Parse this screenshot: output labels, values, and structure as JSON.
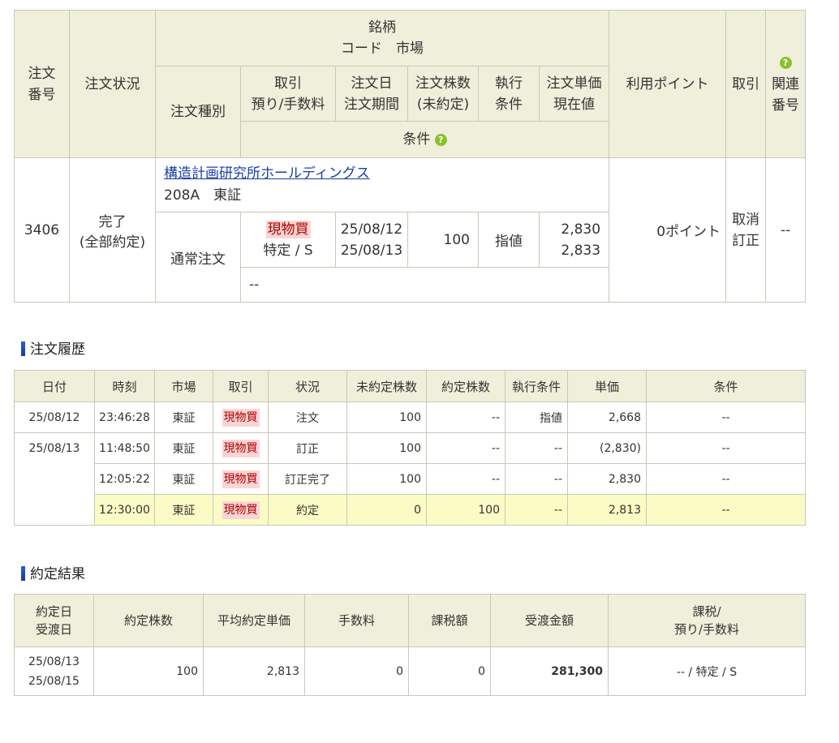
{
  "order_table": {
    "headers": {
      "order_no": "注文\n番号",
      "status": "注文状況",
      "stock": "銘柄",
      "code_market": "コード　市場",
      "order_type": "注文種別",
      "trade": "取引",
      "custody_fee": "預り/手数料",
      "order_date": "注文日",
      "order_period": "注文期間",
      "qty": "注文株数",
      "unfilled": "(未約定)",
      "exec": "執行",
      "condition": "条件",
      "unit_price": "注文単価",
      "current_price": "現在値",
      "conditions_label": "条件",
      "points": "利用ポイント",
      "action": "取引",
      "related_l1": "関連",
      "related_l2": "番号"
    },
    "row": {
      "order_no": "3406",
      "status_l1": "完了",
      "status_l2": "(全部約定)",
      "stock_name": "構造計画研究所ホールディングス",
      "code_market": "208A　東証",
      "order_type": "通常注文",
      "trade": "現物買",
      "custody": "特定 / S",
      "order_date": "25/08/12",
      "order_period": "25/08/13",
      "qty": "100",
      "exec_cond": "指値",
      "unit_price": "2,830",
      "current_price": "2,833",
      "conditions": "--",
      "points": "0ポイント",
      "action_cancel": "取消",
      "action_modify": "訂正",
      "related": "--"
    }
  },
  "history": {
    "title": "注文履歴",
    "headers": [
      "日付",
      "時刻",
      "市場",
      "取引",
      "状況",
      "未約定株数",
      "約定株数",
      "執行条件",
      "単価",
      "条件"
    ],
    "rows": [
      {
        "date": "25/08/12",
        "time": "23:46:28",
        "market": "東証",
        "trade": "現物買",
        "status": "注文",
        "unfilled": "100",
        "filled": "--",
        "exec": "指値",
        "price": "2,668",
        "cond": "--"
      },
      {
        "date": "25/08/13",
        "time": "11:48:50",
        "market": "東証",
        "trade": "現物買",
        "status": "訂正",
        "unfilled": "100",
        "filled": "--",
        "exec": "--",
        "price": "(2,830)",
        "cond": "--"
      },
      {
        "date": "",
        "time": "12:05:22",
        "market": "東証",
        "trade": "現物買",
        "status": "訂正完了",
        "unfilled": "100",
        "filled": "--",
        "exec": "--",
        "price": "2,830",
        "cond": "--"
      },
      {
        "date": "",
        "time": "12:30:00",
        "market": "東証",
        "trade": "現物買",
        "status": "約定",
        "unfilled": "0",
        "filled": "100",
        "exec": "--",
        "price": "2,813",
        "cond": "--"
      }
    ]
  },
  "result": {
    "title": "約定結果",
    "headers": {
      "date_l1": "約定日",
      "date_l2": "受渡日",
      "qty": "約定株数",
      "avg_price": "平均約定単価",
      "fee": "手数料",
      "tax": "課税額",
      "amount": "受渡金額",
      "tax_custody_l1": "課税/",
      "tax_custody_l2": "預り/手数料"
    },
    "row": {
      "exec_date": "25/08/13",
      "settle_date": "25/08/15",
      "qty": "100",
      "avg_price": "2,813",
      "fee": "0",
      "tax": "0",
      "amount": "281,300",
      "tax_custody": "-- / 特定 / S"
    }
  },
  "colors": {
    "header_bg": "#efefdb",
    "highlight_row": "#fbfbc6",
    "buy_badge_bg": "#fbd5d5",
    "buy_badge_fg": "#b00000",
    "link": "#1a3ea8",
    "help_icon": "#8bbf2f",
    "section_bar": "#2a5bd7"
  }
}
